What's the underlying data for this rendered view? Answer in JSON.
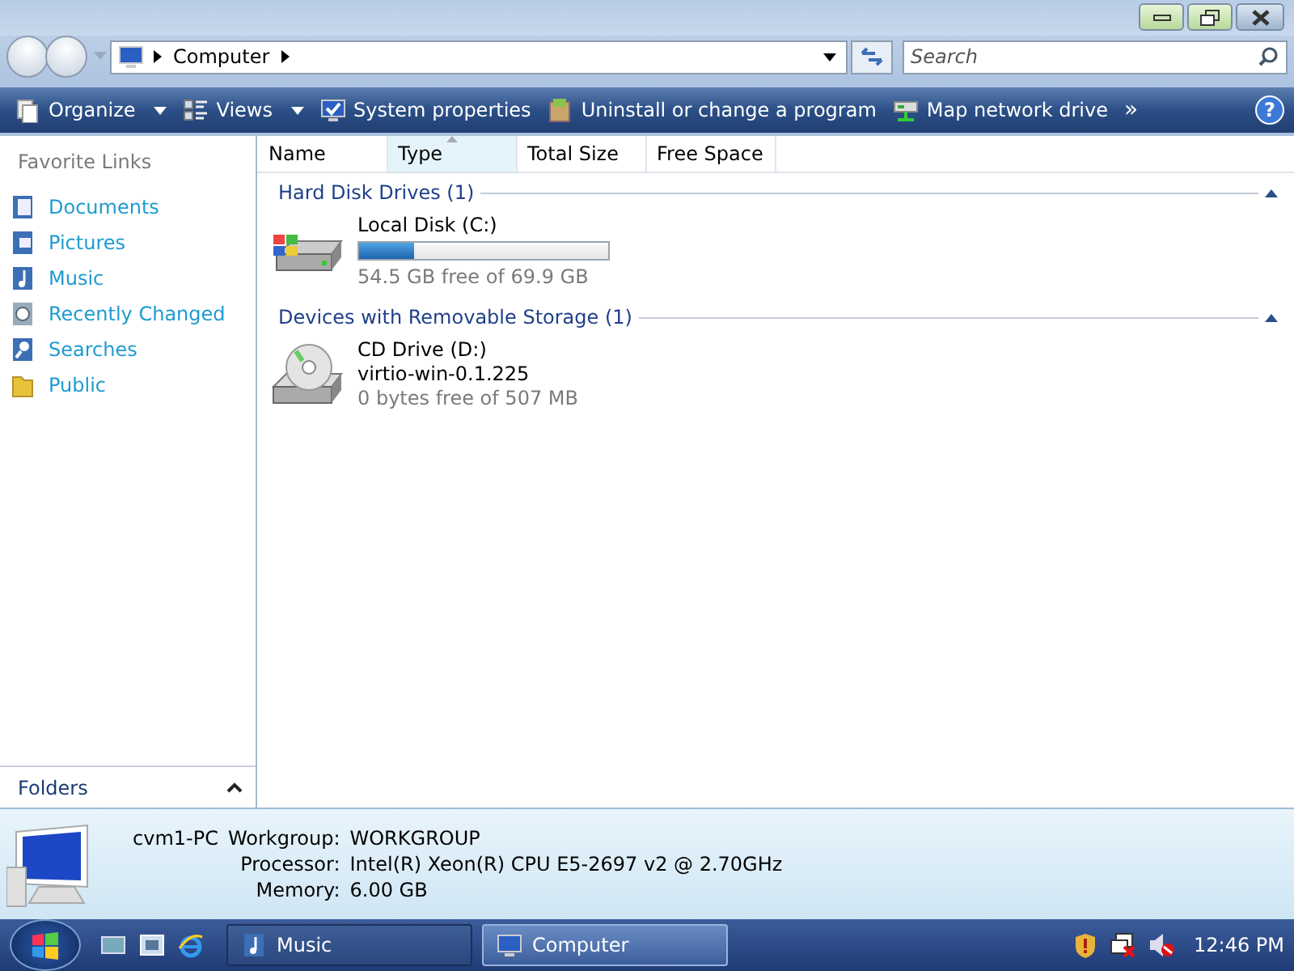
{
  "address_bar": {
    "path": [
      "Computer"
    ]
  },
  "search": {
    "placeholder": "Search"
  },
  "toolbar": [
    {
      "label": "Organize",
      "dropdown": true
    },
    {
      "label": "Views",
      "dropdown": true
    },
    {
      "label": "System properties",
      "dropdown": false
    },
    {
      "label": "Uninstall or change a program",
      "dropdown": false
    },
    {
      "label": "Map network drive",
      "dropdown": false
    }
  ],
  "toolbar_overflow": "»",
  "help": "?",
  "sidebar": {
    "title": "Favorite Links",
    "items": [
      {
        "label": "Documents"
      },
      {
        "label": "Pictures"
      },
      {
        "label": "Music"
      },
      {
        "label": "Recently Changed"
      },
      {
        "label": "Searches"
      },
      {
        "label": "Public"
      }
    ],
    "folders": "Folders"
  },
  "columns": [
    {
      "label": "Name",
      "sorted": false
    },
    {
      "label": "Type",
      "sorted": true
    },
    {
      "label": "Total Size",
      "sorted": false
    },
    {
      "label": "Free Space",
      "sorted": false
    }
  ],
  "groups": [
    {
      "title": "Hard Disk Drives (1)",
      "expanded": true,
      "items": [
        {
          "kind": "disk",
          "name": "Local Disk (C:)",
          "level": 0.22,
          "detail": "54.5 GB free of 69.9 GB"
        }
      ]
    },
    {
      "title": "Devices with Removable Storage (1)",
      "expanded": true,
      "items": [
        {
          "kind": "cd",
          "name": "CD Drive (D:)",
          "label": "virtio-win-0.1.225",
          "detail": "0 bytes free of 507 MB"
        }
      ]
    }
  ],
  "details": {
    "name": "cvm1-PC",
    "rows": [
      {
        "label": "Workgroup:",
        "value": "WORKGROUP"
      },
      {
        "label": "Processor:",
        "value": "Intel(R) Xeon(R) CPU E5-2697 v2 @ 2.70GHz"
      },
      {
        "label": "Memory:",
        "value": "6.00 GB"
      }
    ]
  },
  "taskbar": {
    "buttons": [
      {
        "label": "Music",
        "selected": false
      },
      {
        "label": "Computer",
        "selected": true
      }
    ],
    "clock": "12:46 PM"
  }
}
